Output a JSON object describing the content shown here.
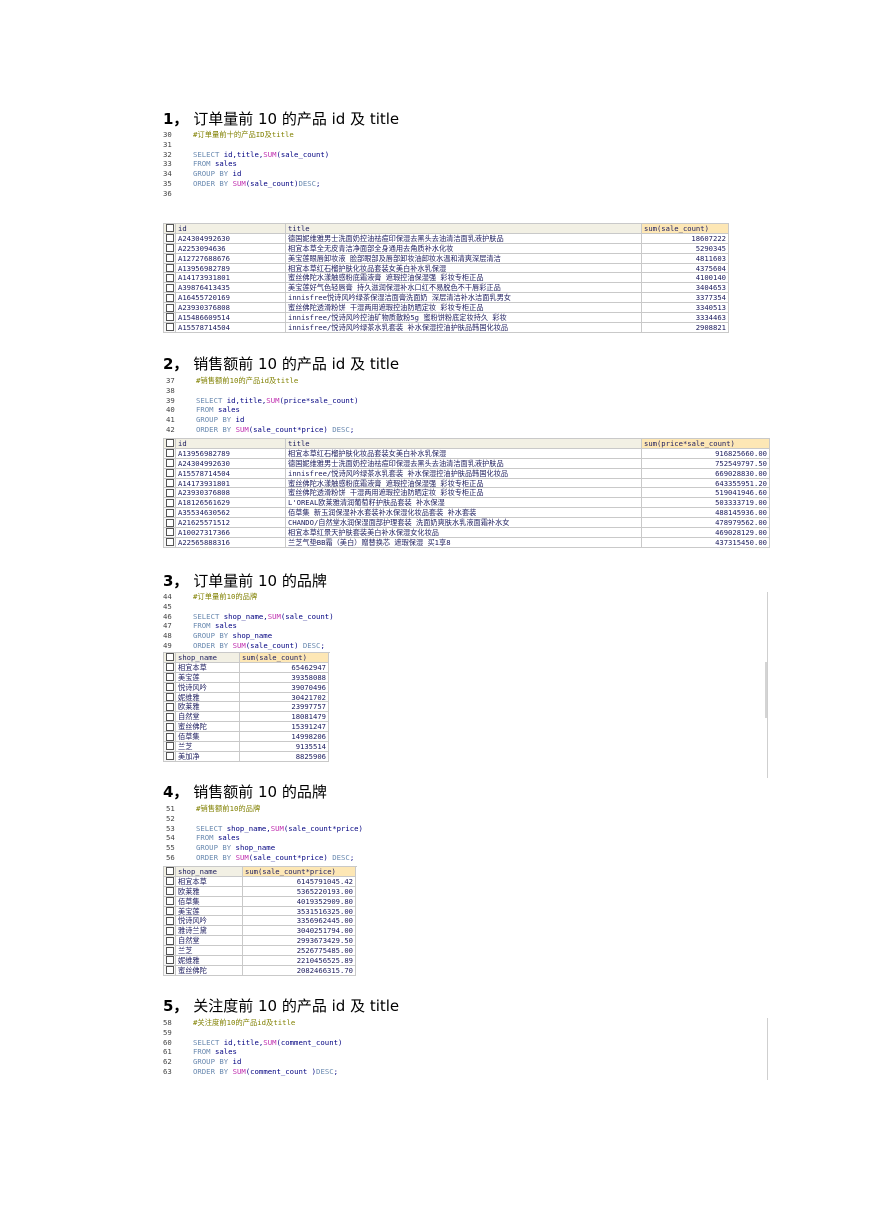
{
  "sections": [
    {
      "number": "1，",
      "title": "订单量前 10 的产品 id 及 title",
      "code": [
        {
          "ln": "30",
          "text": "#订单量前十的产品ID及title"
        },
        {
          "ln": "31",
          "text": ""
        },
        {
          "ln": "32",
          "text": "SELECT id,title,SUM(sale_count)"
        },
        {
          "ln": "33",
          "text": "FROM sales"
        },
        {
          "ln": "34",
          "text": "GROUP BY id"
        },
        {
          "ln": "35",
          "text": "ORDER BY SUM(sale_count)DESC;"
        },
        {
          "ln": "36",
          "text": ""
        }
      ],
      "headers": [
        "id",
        "title",
        "sum(sale_count)"
      ],
      "rows": [
        [
          "A24304992630",
          "德国妮维雅男士洗面奶控油祛痘印保湿去黑头去油清洁面乳液护肤品",
          "18607222"
        ],
        [
          "A2253094636",
          "相宜本草全无皮青洁净面部全身通用去角质补水化妆",
          "5290345"
        ],
        [
          "A12727688676",
          "美宝莲眼唇卸妆液 脸部眼部及唇部卸妆油卸妆水温和清爽深层清洁",
          "4811603"
        ],
        [
          "A13956982789",
          "相宜本草红石榴护肤化妆品套装女美白补水乳保湿",
          "4375604"
        ],
        [
          "A14173931801",
          "蜜丝佛陀水漾触感粉底霜液膏 遮瑕控油保湿强 彩妆专柜正品",
          "4100140"
        ],
        [
          "A39876413435",
          "美宝莲好气色轻唇膏 持久滋润保湿补水口红不易脱色不干唇彩正品",
          "3404653"
        ],
        [
          "A16455720169",
          "innisfree悦诗风吟绿茶保湿洁面膏洗面奶 深层清洁补水洁面乳男女",
          "3377354"
        ],
        [
          "A23930376808",
          "蜜丝佛陀透滑粉饼 干湿两用遮瑕控油防晒定妆 彩妆专柜正品",
          "3340513"
        ],
        [
          "A15486609514",
          "innisfree/悦诗风吟控油矿物质散粉5g 蜜粉饼粉底定妆持久 彩妆",
          "3334463"
        ],
        [
          "A15578714504",
          "innisfree/悦诗风吟绿茶水乳套装 补水保湿控油护肤品韩国化妆品",
          "2908821"
        ]
      ]
    },
    {
      "number": "2，",
      "title": "销售额前 10 的产品 id 及 title",
      "code": [
        {
          "ln": "37",
          "text": "#销售额前10的产品id及title"
        },
        {
          "ln": "38",
          "text": ""
        },
        {
          "ln": "39",
          "text": "SELECT id,title,SUM(price*sale_count)"
        },
        {
          "ln": "40",
          "text": "FROM sales"
        },
        {
          "ln": "41",
          "text": "GROUP BY id"
        },
        {
          "ln": "42",
          "text": "ORDER BY SUM(sale_count*price) DESC;"
        }
      ],
      "headers": [
        "id",
        "title",
        "sum(price*sale_count)"
      ],
      "rows": [
        [
          "A13956982789",
          "相宜本草红石榴护肤化妆品套装女美白补水乳保湿",
          "916825660.00"
        ],
        [
          "A24304992630",
          "德国妮维雅男士洗面奶控油祛痘印保湿去黑头去油清洁面乳液护肤品",
          "752549797.50"
        ],
        [
          "A15578714504",
          "innisfree/悦诗风吟绿茶水乳套装 补水保湿控油护肤品韩国化妆品",
          "669028830.00"
        ],
        [
          "A14173931801",
          "蜜丝佛陀水漾触感粉底霜液膏 遮瑕控油保湿强 彩妆专柜正品",
          "643355951.20"
        ],
        [
          "A23930376808",
          "蜜丝佛陀透滑粉饼 干湿两用遮瑕控油防晒定妆 彩妆专柜正品",
          "519041946.60"
        ],
        [
          "A18126561629",
          "L'OREAL欧莱雅清润葡萄籽护肤品套装 补水保湿",
          "503333719.00"
        ],
        [
          "A35534630562",
          "佰草集 新玉润保湿补水套装补水保湿化妆品套装 补水套装",
          "488145936.00"
        ],
        [
          "A21625571512",
          "CHANDO/自然堂水润保湿面部护理套装 洗面奶爽肤水乳液面霜补水女",
          "478979562.00"
        ],
        [
          "A10027317366",
          "相宜本草红景天护肤套装美白补水保湿女化妆品",
          "469028129.00"
        ],
        [
          "A22565888316",
          "兰芝气垫BB霜（美白）赠替换芯 遮瑕保湿 买1享8",
          "437315450.00"
        ]
      ]
    },
    {
      "number": "3，",
      "title": "订单量前 10 的品牌",
      "code": [
        {
          "ln": "44",
          "text": "#订单量前10的品牌"
        },
        {
          "ln": "45",
          "text": ""
        },
        {
          "ln": "46",
          "text": "SELECT shop_name,SUM(sale_count)"
        },
        {
          "ln": "47",
          "text": "FROM sales"
        },
        {
          "ln": "48",
          "text": "GROUP BY shop_name"
        },
        {
          "ln": "49",
          "text": "ORDER BY SUM(sale_count) DESC;"
        }
      ],
      "headers": [
        "shop_name",
        "sum(sale_count)"
      ],
      "rows": [
        [
          "相宜本草",
          "65462947"
        ],
        [
          "美宝莲",
          "39358088"
        ],
        [
          "悦诗风吟",
          "39070496"
        ],
        [
          "妮维雅",
          "30421702"
        ],
        [
          "欧莱雅",
          "23997757"
        ],
        [
          "自然堂",
          "18081479"
        ],
        [
          "蜜丝佛陀",
          "15391247"
        ],
        [
          "佰草集",
          "14998206"
        ],
        [
          "兰芝",
          "9135514"
        ],
        [
          "美加净",
          "8825906"
        ]
      ]
    },
    {
      "number": "4，",
      "title": "销售额前 10 的品牌",
      "code": [
        {
          "ln": "51",
          "text": "#销售额前10的品牌"
        },
        {
          "ln": "52",
          "text": ""
        },
        {
          "ln": "53",
          "text": "SELECT shop_name,SUM(sale_count*price)"
        },
        {
          "ln": "54",
          "text": "FROM sales"
        },
        {
          "ln": "55",
          "text": "GROUP BY shop_name"
        },
        {
          "ln": "56",
          "text": "ORDER BY SUM(sale_count*price) DESC;"
        }
      ],
      "headers": [
        "shop_name",
        "sum(sale_count*price)"
      ],
      "rows": [
        [
          "相宜本草",
          "6145791045.42"
        ],
        [
          "欧莱雅",
          "5365220193.00"
        ],
        [
          "佰草集",
          "4019352909.80"
        ],
        [
          "美宝莲",
          "3531516325.00"
        ],
        [
          "悦诗风吟",
          "3356962445.00"
        ],
        [
          "雅诗兰黛",
          "3040251794.00"
        ],
        [
          "自然堂",
          "2993673429.50"
        ],
        [
          "兰芝",
          "2526775485.00"
        ],
        [
          "妮维雅",
          "2210456525.89"
        ],
        [
          "蜜丝佛陀",
          "2082466315.70"
        ]
      ]
    },
    {
      "number": "5，",
      "title": "关注度前 10 的产品 id 及 title",
      "code": [
        {
          "ln": "58",
          "text": "#关注度前10的产品id及title"
        },
        {
          "ln": "59",
          "text": ""
        },
        {
          "ln": "60",
          "text": "SELECT id,title,SUM(comment_count)"
        },
        {
          "ln": "61",
          "text": "FROM sales"
        },
        {
          "ln": "62",
          "text": "GROUP BY id"
        },
        {
          "ln": "63",
          "text": "ORDER BY SUM(comment_count )DESC;"
        }
      ]
    }
  ]
}
